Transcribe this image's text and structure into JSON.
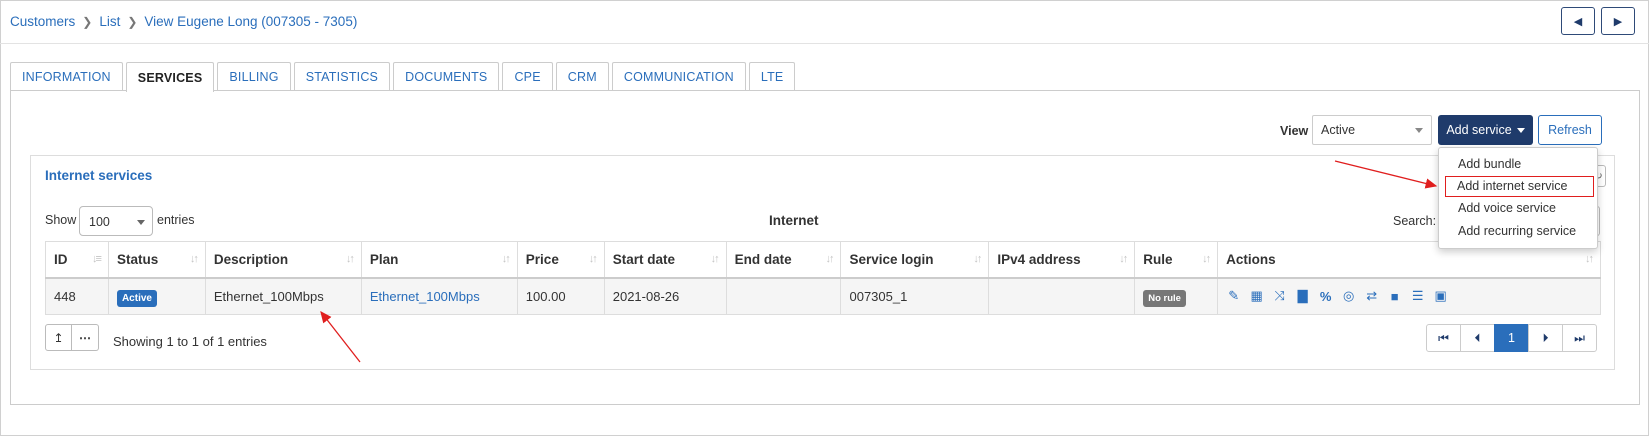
{
  "breadcrumb": {
    "items": [
      "Customers",
      "List",
      "View Eugene Long (007305 - 7305)"
    ]
  },
  "nav": {
    "prev_icon": "triangle-left-icon",
    "next_icon": "triangle-right-icon"
  },
  "tabs": [
    {
      "label": "INFORMATION",
      "active": false
    },
    {
      "label": "SERVICES",
      "active": true
    },
    {
      "label": "BILLING",
      "active": false
    },
    {
      "label": "STATISTICS",
      "active": false
    },
    {
      "label": "DOCUMENTS",
      "active": false
    },
    {
      "label": "CPE",
      "active": false
    },
    {
      "label": "CRM",
      "active": false
    },
    {
      "label": "COMMUNICATION",
      "active": false
    },
    {
      "label": "LTE",
      "active": false
    }
  ],
  "toolbar": {
    "view_label": "View",
    "view_value": "Active",
    "add_service_label": "Add service",
    "refresh_label": "Refresh"
  },
  "add_service_menu": {
    "items": [
      "Add bundle",
      "Add internet service",
      "Add voice service",
      "Add recurring service"
    ],
    "highlighted": "Add internet service"
  },
  "panel": {
    "title": "Internet services",
    "show_label": "Show",
    "entries_value": "100",
    "entries_label": "entries",
    "caption": "Internet",
    "search_label": "Search:"
  },
  "table": {
    "columns": [
      "ID",
      "Status",
      "Description",
      "Plan",
      "Price",
      "Start date",
      "End date",
      "Service login",
      "IPv4 address",
      "Rule",
      "Actions"
    ],
    "rows": [
      {
        "id": "448",
        "status": "Active",
        "description": "Ethernet_100Mbps",
        "plan": "Ethernet_100Mbps",
        "price": "100.00",
        "start_date": "2021-08-26",
        "end_date": "",
        "service_login": "007305_1",
        "ipv4": "",
        "rule": "No rule"
      }
    ],
    "action_icons": [
      "edit-icon",
      "calendar-icon",
      "shuffle-icon",
      "chart-icon",
      "percent-icon",
      "map-marker-icon",
      "retweet-icon",
      "file-icon",
      "list-icon",
      "trash-icon"
    ]
  },
  "footer": {
    "showing_text": "Showing 1 to 1 of 1 entries",
    "current_page": "1"
  },
  "colors": {
    "link": "#2a6ebb",
    "primary": "#1f3b6b",
    "annotation": "#e01e1e"
  }
}
